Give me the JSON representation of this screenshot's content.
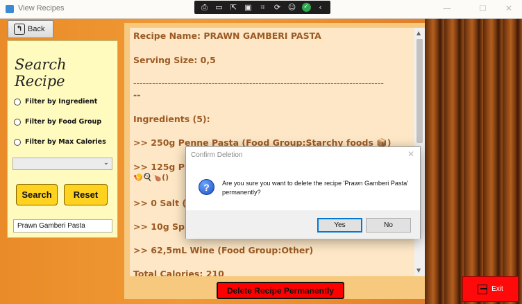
{
  "window": {
    "title": "View Recipes"
  },
  "back_label": "Back",
  "search": {
    "title": "Search Recipe",
    "filters": [
      "Filter by Ingredient",
      "Filter by Food Group",
      "Filter by Max Calories"
    ],
    "search_label": "Search",
    "reset_label": "Reset",
    "input_value": "Prawn Gamberi Pasta"
  },
  "recipe": {
    "lines": [
      "Recipe Name: PRAWN GAMBERI PASTA",
      "Serving Size: 0,5",
      "--------------------------------------------------------------------------------",
      "--",
      "Ingredients (5):",
      ">> 250g  Penne Pasta    (Food Group:Starchy foods 📦)",
      ">> 125g  Prav",
      "🍤🍳🍗()",
      ">> 0 Salt   (F",
      ">> 10g  Spice",
      ">> 62,5mL  Wine   (Food Group:Other)",
      "Total Calories: 210"
    ]
  },
  "delete_label": "Delete Recipe Permanently",
  "exit_label": "Exit",
  "dialog": {
    "title": "Confirm Deletion",
    "message": "Are you sure you want to delete the recipe 'Prawn Gamberi Pasta' permanently?",
    "yes_label": "Yes",
    "no_label": "No"
  },
  "colors": {
    "accent_red": "#ff0000",
    "button_yellow": "#ffd21f",
    "panel_cream": "#fffbbe",
    "recipe_text": "#9c5a23"
  }
}
